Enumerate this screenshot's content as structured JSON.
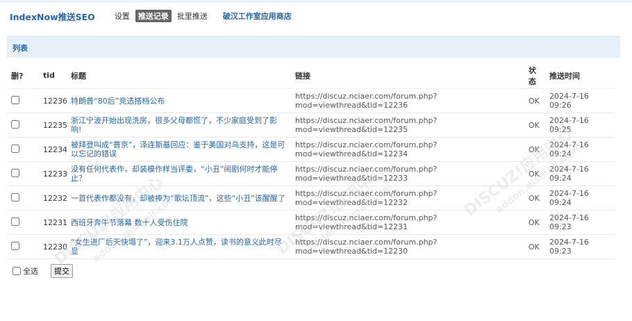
{
  "nav": {
    "brand": "IndexNow推送SEO",
    "items": [
      "设置",
      "推送记录",
      "批里推送"
    ],
    "active_index": 1,
    "store_link": "破汉工作室应用商店"
  },
  "section": {
    "title": "列表"
  },
  "table": {
    "headers": {
      "del": "删?",
      "tid": "tid",
      "title": "标题",
      "link": "链接",
      "status": "状态",
      "time": "推送时间"
    },
    "rows": [
      {
        "tid": "12236",
        "title": "特朗普“80后”竞选搭档公布",
        "link": "https://discuz.nciaer.com/forum.php?mod=viewthread&tid=12236",
        "status": "OK",
        "time": "2024-7-16 09:26"
      },
      {
        "tid": "12235",
        "title": "浙江宁波开始出现洗房，很多父母都慌了，不少家庭受到了影响!",
        "link": "https://discuz.nciaer.com/forum.php?mod=viewthread&tid=12235",
        "status": "OK",
        "time": "2024-7-16 09:25"
      },
      {
        "tid": "12234",
        "title": "被拜登叫成“普京”，泽连斯基回应：鉴于美国对乌支持，这是可以忘记的错误",
        "link": "https://discuz.nciaer.com/forum.php?mod=viewthread&tid=12234",
        "status": "OK",
        "time": "2024-7-16 09:24"
      },
      {
        "tid": "12233",
        "title": "没有任何代表作，却装模作样当评委，“小丑”闹剧何时才能停止？",
        "link": "https://discuz.nciaer.com/forum.php?mod=viewthread&tid=12233",
        "status": "OK",
        "time": "2024-7-16 09:24"
      },
      {
        "tid": "12232",
        "title": "一首代表作都没有，却被捧为“歌坛顶流”，这些“小丑”该醒醒了",
        "link": "https://discuz.nciaer.com/forum.php?mod=viewthread&tid=12232",
        "status": "OK",
        "time": "2024-7-16 09:24"
      },
      {
        "tid": "12231",
        "title": "西班牙奔牛节落幕 数十人受伤住院",
        "link": "https://discuz.nciaer.com/forum.php?mod=viewthread&tid=12231",
        "status": "OK",
        "time": "2024-7-16 09:23"
      },
      {
        "tid": "12230",
        "title": "“女生进厂后天快塌了”，迎来3.1万人点赞，读书的意义此时尽显",
        "link": "https://discuz.nciaer.com/forum.php?mod=viewthread&tid=12230",
        "status": "OK",
        "time": "2024-7-16 09:23"
      }
    ]
  },
  "footer": {
    "select_all": "全选",
    "submit": "提交"
  },
  "watermark": {
    "text": "DISCUZ!应用中心",
    "sub": "addon.dismall.com"
  }
}
